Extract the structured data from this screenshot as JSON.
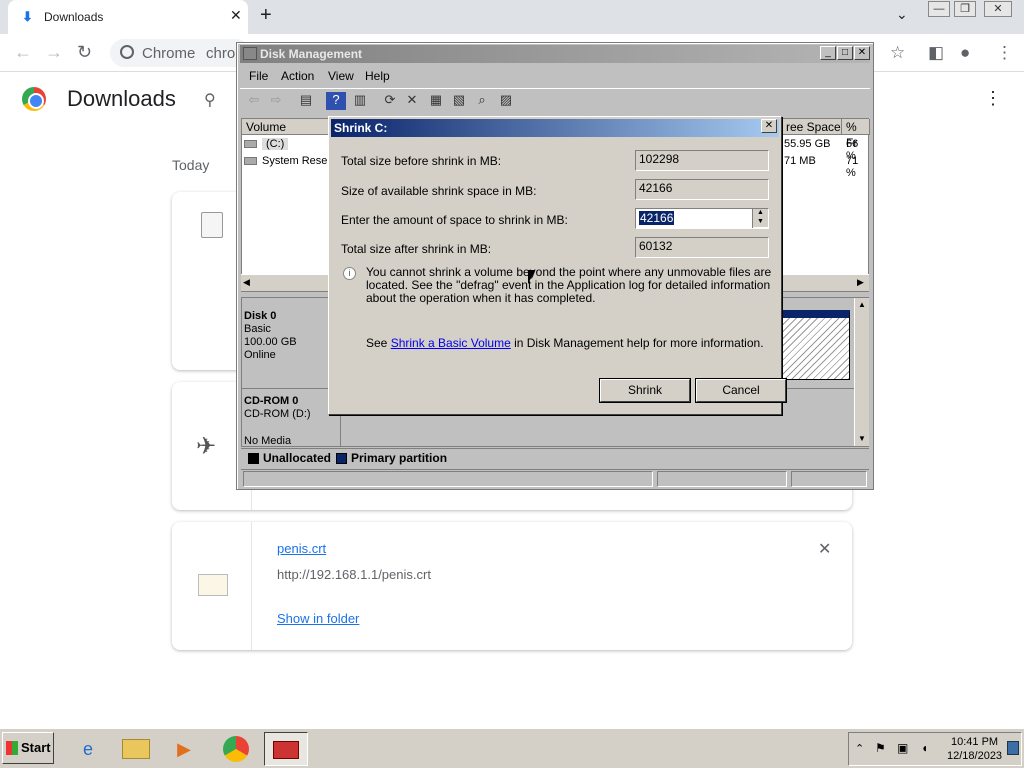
{
  "browser": {
    "tab_title": "Downloads",
    "omnibox_chip": "Chrome",
    "omnibox_text": "chro"
  },
  "downloads": {
    "title": "Downloads",
    "section": "Today",
    "items": [
      {
        "name": "",
        "url": ""
      },
      {
        "name": "",
        "url": ""
      },
      {
        "name": "penis.crt",
        "url": "http://192.168.1.1/penis.crt",
        "action": "Show in folder"
      }
    ]
  },
  "disk_mgmt": {
    "title": "Disk Management",
    "menu": [
      "File",
      "Action",
      "View",
      "Help"
    ],
    "columns": [
      "Volume",
      "ree Space",
      "% Fr"
    ],
    "rows": [
      {
        "volume": "(C:)",
        "free": "55.95 GB",
        "pct": "66 %"
      },
      {
        "volume": "System Reser",
        "free": "71 MB",
        "pct": "71 %"
      }
    ],
    "disk0": {
      "name": "Disk 0",
      "type": "Basic",
      "size": "100.00 GB",
      "state": "Online"
    },
    "cdrom": {
      "name": "CD-ROM 0",
      "drive": "CD-ROM (D:)",
      "media": "No Media"
    },
    "legend": [
      "Unallocated",
      "Primary partition"
    ]
  },
  "shrink": {
    "title": "Shrink C:",
    "total_before_label": "Total size before shrink in MB:",
    "total_before": "102298",
    "available_label": "Size of available shrink space in MB:",
    "available": "42166",
    "amount_label": "Enter the amount of space to shrink in MB:",
    "amount": "42166",
    "total_after_label": "Total size after shrink in MB:",
    "total_after": "60132",
    "info": "You cannot shrink a volume beyond the point where any unmovable files are located. See the \"defrag\" event in the Application log for detailed information about the operation when it has completed.",
    "see_prefix": "See ",
    "see_link": "Shrink a Basic Volume",
    "see_suffix": " in Disk Management help for more information.",
    "shrink_button": "Shrink",
    "cancel_button": "Cancel"
  },
  "taskbar": {
    "start": "Start",
    "time": "10:41 PM",
    "date": "12/18/2023"
  }
}
